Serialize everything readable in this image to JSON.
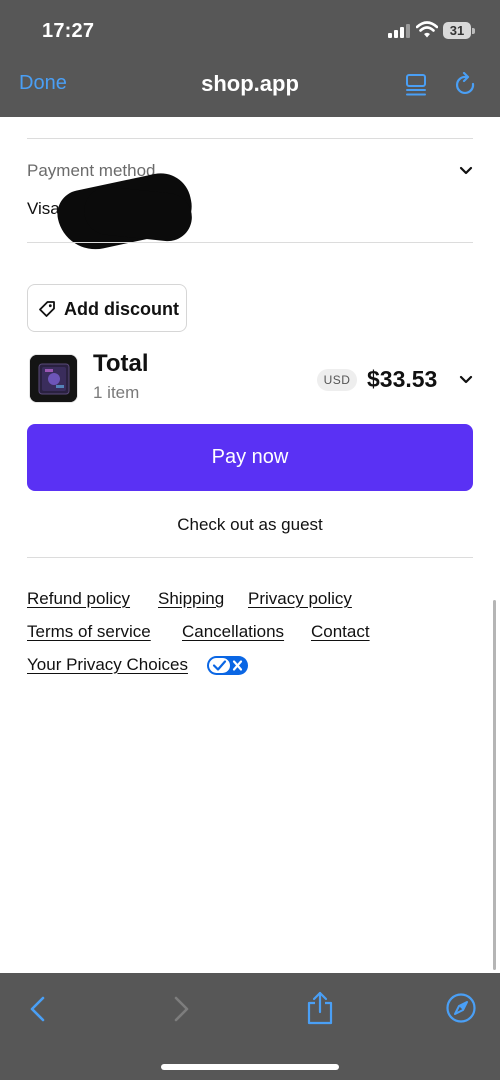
{
  "status_bar": {
    "time": "17:27",
    "battery": "31",
    "icons": [
      "signal-icon",
      "wifi-icon",
      "battery-icon"
    ]
  },
  "nav": {
    "done_label": "Done",
    "title": "shop.app",
    "icons": [
      "reader-icon",
      "reload-icon"
    ]
  },
  "payment": {
    "label": "Payment method",
    "value": "Visa ···"
  },
  "discount": {
    "label": "Add discount",
    "icon": "tag-icon"
  },
  "summary": {
    "total_label": "Total",
    "item_count": "1 item",
    "currency": "USD",
    "amount": "$33.53"
  },
  "actions": {
    "pay_label": "Pay now",
    "guest_label": "Check out as guest"
  },
  "policies": {
    "refund": "Refund policy",
    "shipping": "Shipping",
    "privacy": "Privacy policy",
    "terms": "Terms of service",
    "cancellations": "Cancellations",
    "contact": "Contact",
    "privacy_choices": "Your Privacy Choices"
  },
  "toolbar": {
    "icons": [
      "back-icon",
      "forward-icon",
      "share-icon",
      "compass-icon"
    ]
  },
  "colors": {
    "chrome": "#575757",
    "accent_blue": "#4a9ff5",
    "pay_purple": "#5a31f4",
    "privacy_toggle": "#0a66e4"
  }
}
